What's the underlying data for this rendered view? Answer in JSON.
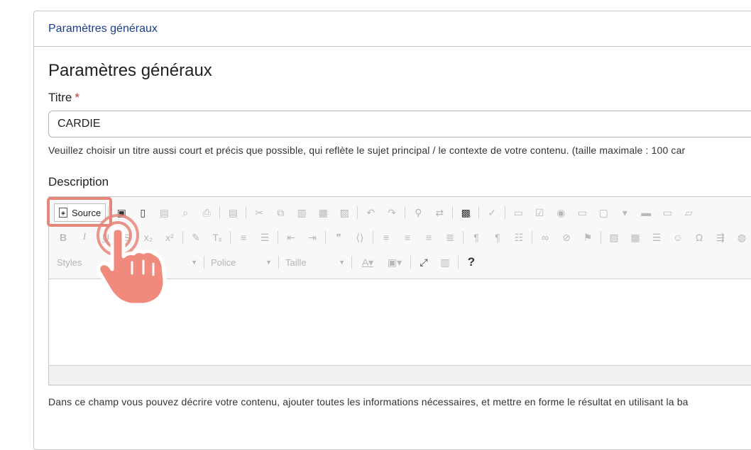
{
  "panel": {
    "header_title": "Paramètres généraux"
  },
  "form": {
    "section_title": "Paramètres généraux",
    "title_label": "Titre",
    "required_mark": "*",
    "title_value": "CARDIE",
    "title_help": "Veuillez choisir un titre aussi court et précis que possible, qui reflète le sujet principal / le contexte de votre contenu. (taille maximale : 100 car",
    "description_label": "Description",
    "description_help": "Dans ce champ vous pouvez décrire votre contenu, ajouter toutes les informations nécessaires, et mettre en forme le résultat en utilisant la ba"
  },
  "toolbar": {
    "source_label": "Source",
    "styles_placeholder": "Styles",
    "font_placeholder": "Police",
    "size_placeholder": "Taille",
    "help_glyph": "?"
  },
  "colors": {
    "header_text": "#1a3c8c",
    "highlight": "#e6857a",
    "required": "#c0392b"
  }
}
